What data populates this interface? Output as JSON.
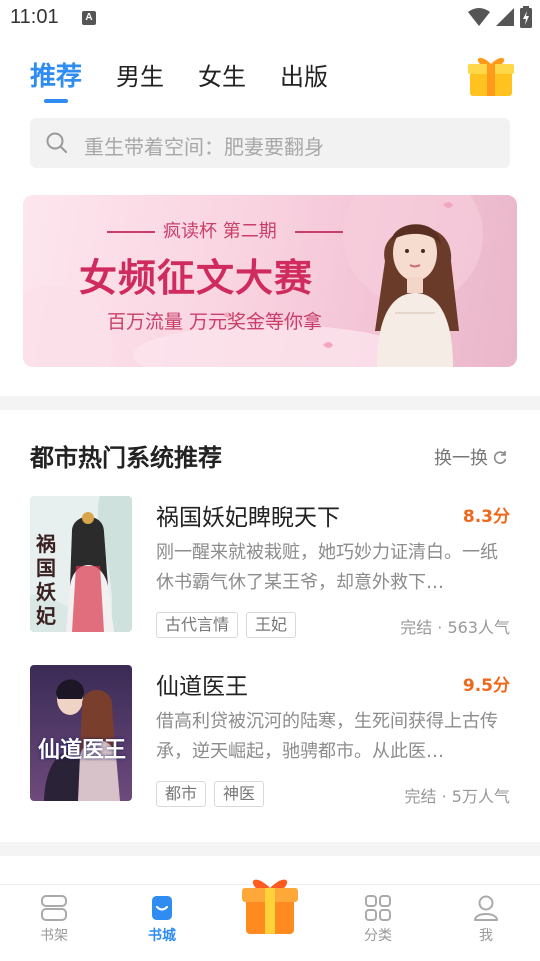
{
  "status": {
    "time": "11:01",
    "notif_letter": "A"
  },
  "tabs": [
    {
      "label": "推荐",
      "active": true
    },
    {
      "label": "男生",
      "active": false
    },
    {
      "label": "女生",
      "active": false
    },
    {
      "label": "出版",
      "active": false
    }
  ],
  "search": {
    "placeholder": "重生带着空间：肥妻要翻身"
  },
  "banner": {
    "subtitle": "疯读杯 第二期",
    "title": "女频征文大赛",
    "tagline": "百万流量  万元奖金等你拿"
  },
  "section": {
    "title": "都市热门系统推荐",
    "refresh_label": "换一换"
  },
  "books": [
    {
      "title": "祸国妖妃睥睨天下",
      "score": "8.3分",
      "desc": "刚一醒来就被栽赃，她巧妙力证清白。一纸休书霸气休了某王爷，却意外救下…",
      "tags": [
        "古代言情",
        "王妃"
      ],
      "meta": "完结 · 563人气",
      "cover_text": "祸国妖妃"
    },
    {
      "title": "仙道医王",
      "score": "9.5分",
      "desc": "借高利贷被沉河的陆寒，生死间获得上古传承，逆天崛起，驰骋都市。从此医…",
      "tags": [
        "都市",
        "神医"
      ],
      "meta": "完结 · 5万人气",
      "cover_text": "仙道医王"
    }
  ],
  "nav": [
    {
      "label": "书架",
      "icon": "bookshelf-icon",
      "active": false
    },
    {
      "label": "书城",
      "icon": "bookstore-icon",
      "active": true
    },
    {
      "label": "分类",
      "icon": "category-icon",
      "active": false
    },
    {
      "label": "我",
      "icon": "profile-icon",
      "active": false
    }
  ],
  "colors": {
    "accent": "#2f8cf0",
    "score": "#f0671a",
    "banner_title": "#d02b5e"
  }
}
